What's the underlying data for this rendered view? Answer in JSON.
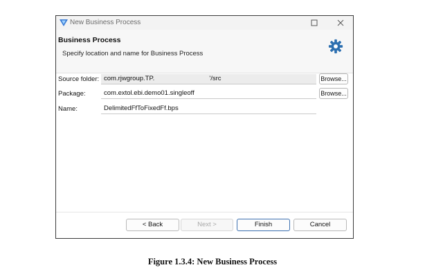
{
  "window": {
    "title": "New Business Process",
    "icons": {
      "app": "extol-logo-icon",
      "maximize": "maximize-icon",
      "close": "close-icon"
    }
  },
  "header": {
    "title": "Business Process",
    "description": "Specify location and name for Business Process",
    "icon": "gear-icon",
    "icon_color": "#2c6fb0"
  },
  "form": {
    "source_folder": {
      "label": "Source folder:",
      "value": "com.rjwgroup.TP.                              '/src",
      "button": "Browse..."
    },
    "package": {
      "label": "Package:",
      "value": "com.extol.ebi.demo01.singleoff",
      "button": "Browse..."
    },
    "name": {
      "label": "Name:",
      "value": "DelimitedFfToFixedFf.bps"
    }
  },
  "footer": {
    "back": "< Back",
    "next": "Next >",
    "finish": "Finish",
    "cancel": "Cancel"
  },
  "caption": "Figure 1.3.4: New Business Process"
}
